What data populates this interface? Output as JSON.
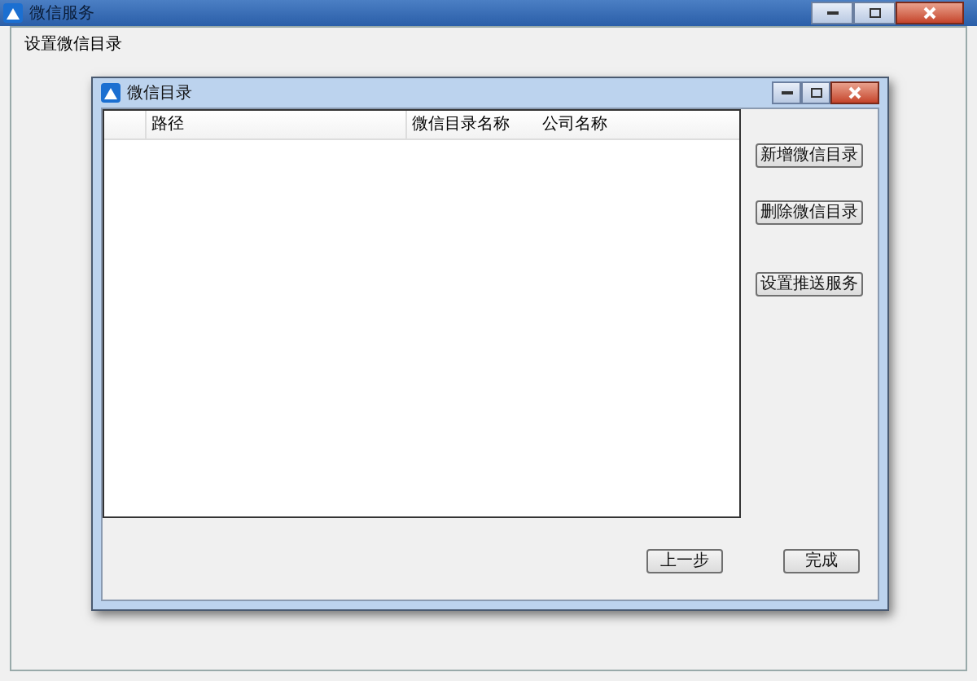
{
  "window": {
    "title": "微信服务"
  },
  "heading": "设置微信目录",
  "dialog": {
    "title": "微信目录",
    "table": {
      "columns": [
        "路径",
        "微信目录名称",
        "公司名称"
      ]
    },
    "side_buttons": [
      "新增微信目录",
      "删除微信目录",
      "设置推送服务"
    ],
    "bottom_buttons": [
      "上一步",
      "完成"
    ]
  }
}
